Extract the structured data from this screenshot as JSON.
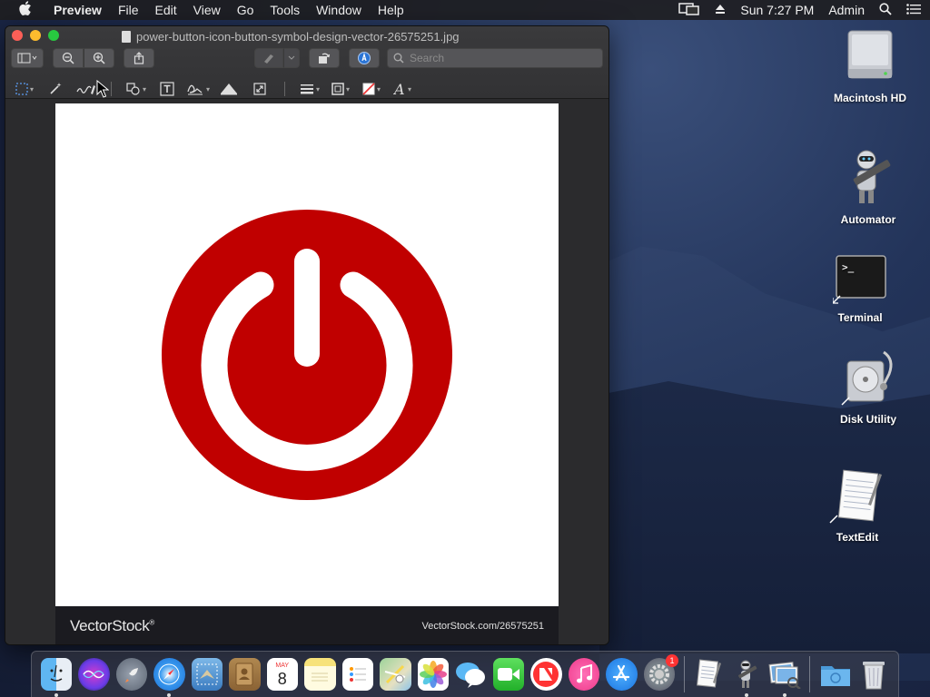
{
  "menubar": {
    "apple": "",
    "items": [
      "Preview",
      "File",
      "Edit",
      "View",
      "Go",
      "Tools",
      "Window",
      "Help"
    ],
    "clock": "Sun 7:27 PM",
    "user": "Admin"
  },
  "window": {
    "title": "power-button-icon-button-symbol-design-vector-26575251.jpg",
    "search_placeholder": "Search"
  },
  "image": {
    "watermark_brand": "VectorStock",
    "watermark_reg": "®",
    "watermark_url": "VectorStock.com/26575251",
    "icon_color": "#c00000"
  },
  "desktop": {
    "icons": [
      {
        "label": "Macintosh HD"
      },
      {
        "label": "Automator"
      },
      {
        "label": "Terminal"
      },
      {
        "label": "Disk Utility"
      },
      {
        "label": "TextEdit"
      }
    ]
  },
  "dock": {
    "calendar_month": "MAY",
    "calendar_day": "8",
    "appstore_badge": "1"
  }
}
